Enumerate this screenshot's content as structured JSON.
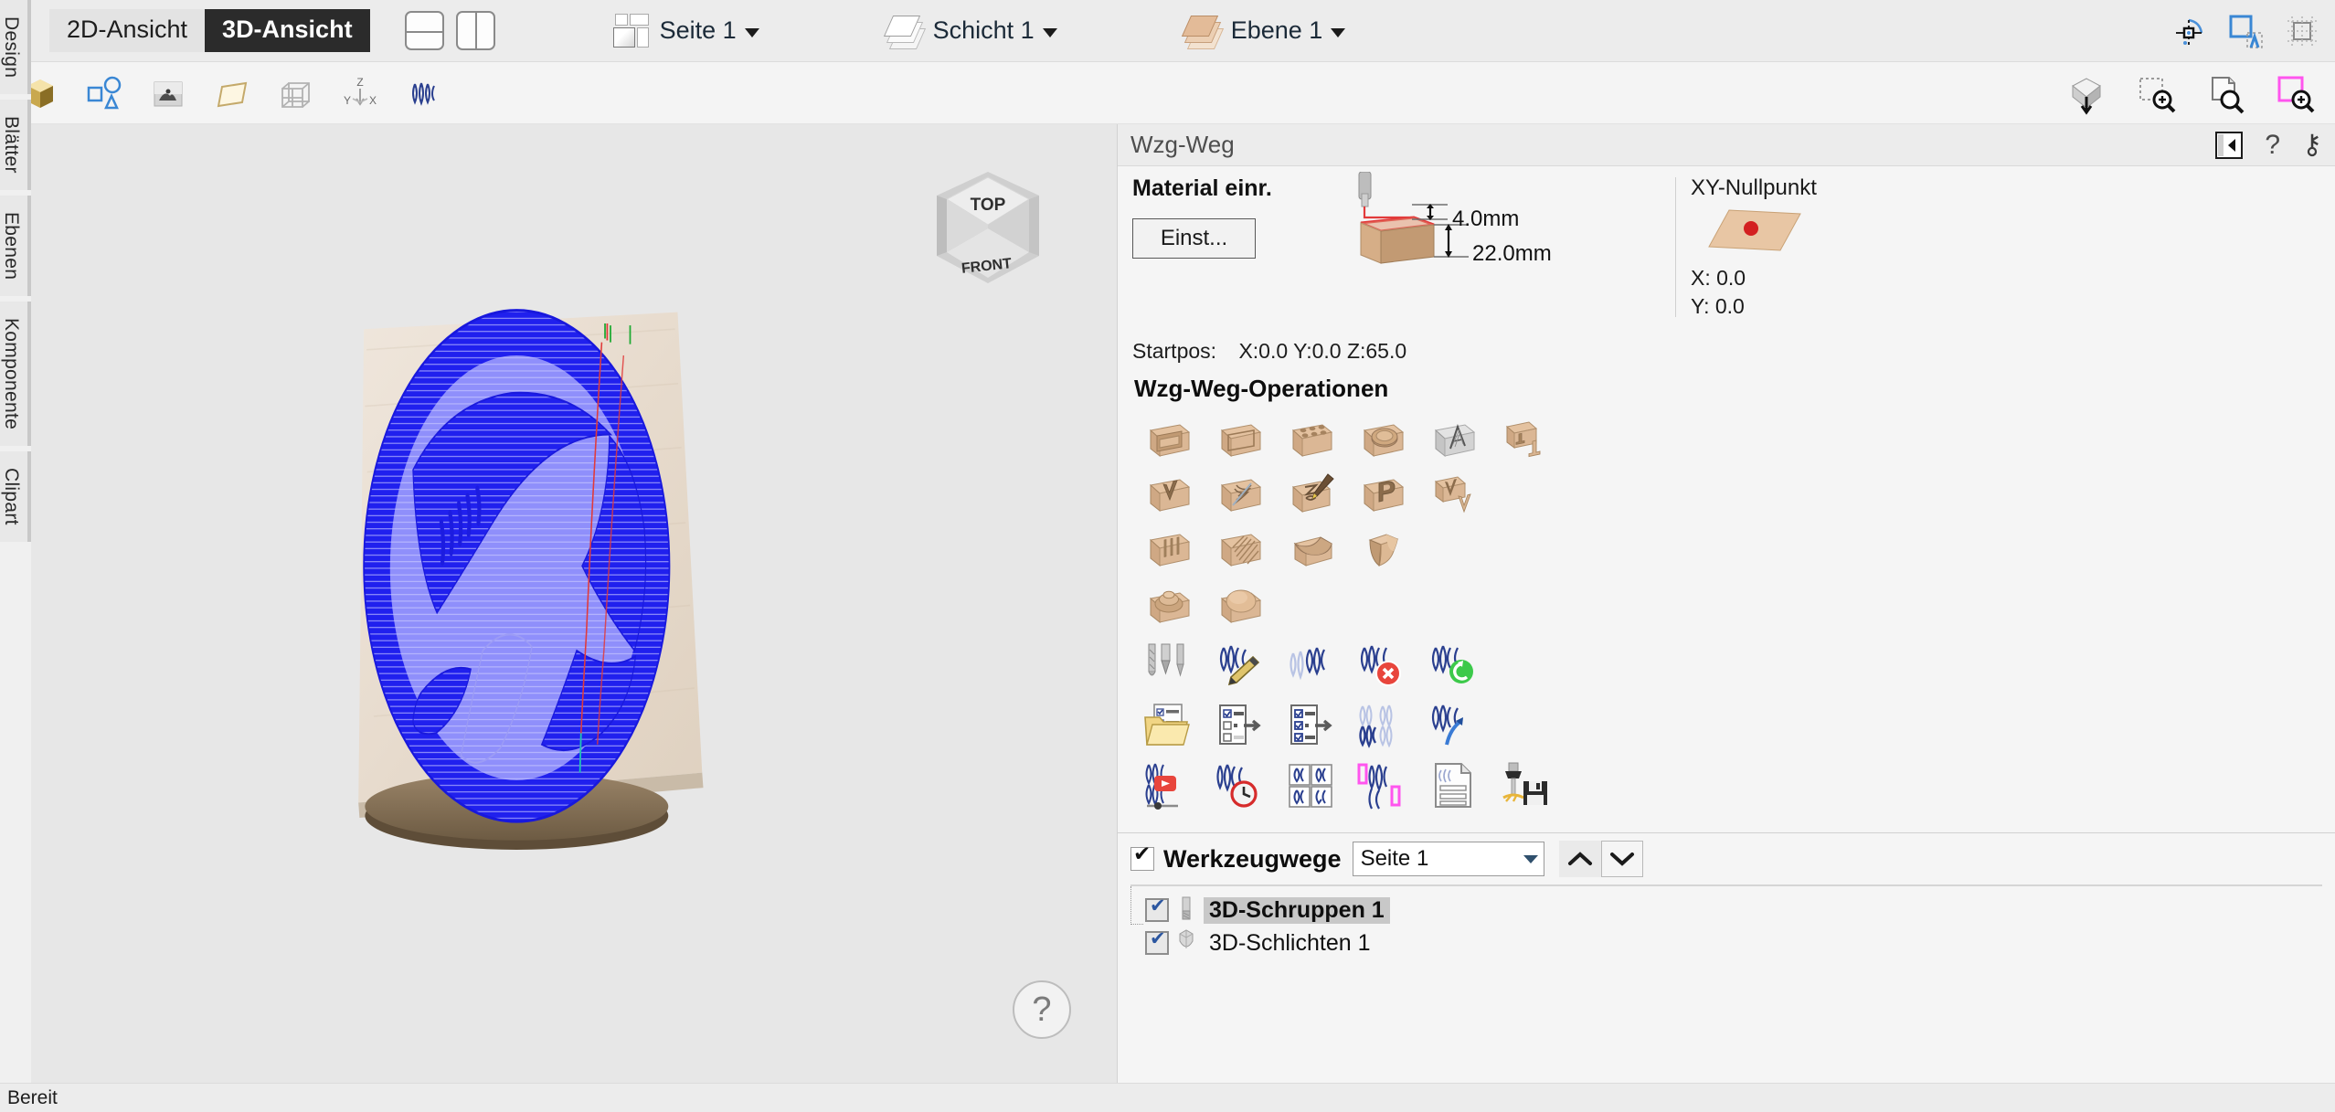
{
  "app": {
    "status_text": "Bereit"
  },
  "side_tabs": [
    {
      "label": "Design",
      "name": "sidebar-tab-design"
    },
    {
      "label": "Blätter",
      "name": "sidebar-tab-blaetter"
    },
    {
      "label": "Ebenen",
      "name": "sidebar-tab-ebenen"
    },
    {
      "label": "Komponente",
      "name": "sidebar-tab-komponente"
    },
    {
      "label": "Clipart",
      "name": "sidebar-tab-clipart"
    }
  ],
  "topbar": {
    "view_tabs": [
      {
        "label": "2D-Ansicht",
        "active": false
      },
      {
        "label": "3D-Ansicht",
        "active": true
      }
    ],
    "split_horizontal_tip": "Horizontal teilen",
    "split_vertical_tip": "Vertikal teilen",
    "sheet_dropdown": "Seite 1",
    "schicht_dropdown": "Schicht 1",
    "ebene_dropdown": "Ebene 1"
  },
  "right_panel": {
    "title": "Wzg-Weg",
    "material": {
      "heading": "Material einr.",
      "settings_button": "Einst...",
      "clearance": "4.0mm",
      "thickness": "22.0mm",
      "startpos_label": "Startpos:",
      "startpos_value": "X:0.0 Y:0.0 Z:65.0"
    },
    "xy_zero": {
      "heading": "XY-Nullpunkt",
      "x": "X: 0.0",
      "y": "Y: 0.0"
    },
    "operations_heading": "Wzg-Weg-Operationen",
    "operations_rows": [
      [
        {
          "name": "profile-toolpath-icon",
          "label": "Profilbearbeitung"
        },
        {
          "name": "pocket-toolpath-icon",
          "label": "Taschenbearbeitung"
        },
        {
          "name": "drilling-toolpath-icon",
          "label": "Bohren"
        },
        {
          "name": "fluting-toolpath-icon",
          "label": "Nutfräsen"
        },
        {
          "name": "vcarve-toolpath-icon",
          "label": "V-Schnitt / Gravieren"
        },
        {
          "name": "inlay-toolpath-icon",
          "label": "Inlay"
        }
      ],
      [
        {
          "name": "prism-carving-icon",
          "label": "Prismatisches Fräsen"
        },
        {
          "name": "thread-milling-icon",
          "label": "Gewindefräsen"
        },
        {
          "name": "quick-engrave-icon",
          "label": "Schnellgravur"
        },
        {
          "name": "text-carving-icon",
          "label": "Textgravur"
        },
        {
          "name": "vcarve-inlay-icon",
          "label": "V-Schnitt Inlay"
        }
      ],
      [
        {
          "name": "ribbed-3d-rough-icon",
          "label": "3D-Schruppen"
        },
        {
          "name": "3d-finish-icon",
          "label": "3D-Schlichten"
        },
        {
          "name": "moulding-toolpath-icon",
          "label": "Formfräsen"
        },
        {
          "name": "moulding-profile-icon",
          "label": "Profilformen"
        }
      ],
      [
        {
          "name": "rotary-roughing-icon",
          "label": "Rotations-Schruppen"
        },
        {
          "name": "dome-toolpath-icon",
          "label": "Kuppelfräsen"
        }
      ]
    ],
    "manage_rows": [
      [
        {
          "name": "tool-database-icon",
          "label": "Werkzeugdatenbank"
        },
        {
          "name": "edit-toolpath-icon",
          "label": "Wzg-Weg bearbeiten"
        },
        {
          "name": "duplicate-toolpath-icon",
          "label": "Wzg-Weg duplizieren"
        },
        {
          "name": "delete-toolpath-icon",
          "label": "Wzg-Weg löschen"
        },
        {
          "name": "recalculate-toolpath-icon",
          "label": "Neu berechnen"
        }
      ],
      [
        {
          "name": "toolpath-template-folder-icon",
          "label": "Vorlage laden"
        },
        {
          "name": "save-template-icon",
          "label": "Vorlage speichern"
        },
        {
          "name": "template-list-icon",
          "label": "Vorlagenliste"
        },
        {
          "name": "merge-toolpaths-icon",
          "label": "Wzg-Wege zusammenführen"
        },
        {
          "name": "transform-toolpath-icon",
          "label": "Wzg-Weg transformieren"
        }
      ],
      [
        {
          "name": "simulate-toolpath-icon",
          "label": "Simulation"
        },
        {
          "name": "estimate-time-icon",
          "label": "Zeitschätzung"
        },
        {
          "name": "tile-toolpath-icon",
          "label": "Wzg-Weg kacheln"
        },
        {
          "name": "toolpath-boundary-icon",
          "label": "Wzg-Weg Begrenzung"
        },
        {
          "name": "toolpath-summary-icon",
          "label": "Zusammenfassung"
        },
        {
          "name": "save-toolpath-icon",
          "label": "Wzg-Weg speichern"
        }
      ]
    ],
    "toolpaths": {
      "enabled": true,
      "title": "Werkzeugwege",
      "sheet_value": "Seite 1",
      "items": [
        {
          "label": "3D-Schruppen 1",
          "checked": true,
          "selected": true,
          "tool_icon": "endmill-icon"
        },
        {
          "label": "3D-Schlichten 1",
          "checked": true,
          "selected": false,
          "tool_icon": "ballnose-icon"
        }
      ]
    }
  },
  "canvas": {
    "navcube": {
      "top_label": "TOP",
      "front_label": "FRONT"
    },
    "help_label": "?"
  },
  "colors": {
    "accent_blue": "#2222ee",
    "toolpath_light": "#8d8dfa",
    "wood": "#e5d7c8",
    "active_tab_bg": "#2b2b2b",
    "panel_bg": "#f5f5f5",
    "topbar_bg": "#ececec",
    "canvas_bg": "#e7e7e7",
    "red_marker": "#e03a3a",
    "green_marker": "#22aa33",
    "magenta": "#ff55ee"
  }
}
